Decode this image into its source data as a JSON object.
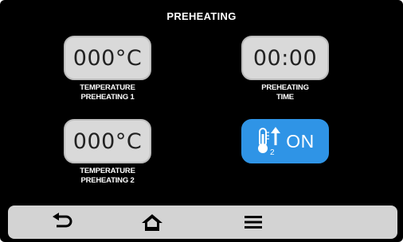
{
  "screen": {
    "title": "PREHEATING"
  },
  "tiles": {
    "temp1": {
      "value": "000°C",
      "caption_line1": "TEMPERATURE",
      "caption_line2": "PREHEATING 1"
    },
    "time": {
      "value": "00:00",
      "caption_line1": "PREHEATING",
      "caption_line2": "TIME"
    },
    "temp2": {
      "value": "000°C",
      "caption_line1": "TEMPERATURE",
      "caption_line2": "PREHEATING 2"
    },
    "toggle": {
      "label": "ON",
      "icon": "thermometer-up-2-icon",
      "sub_label": "2"
    }
  },
  "nav": {
    "back_icon": "back-arrow-icon",
    "home_icon": "home-icon",
    "menu_icon": "menu-icon"
  },
  "colors": {
    "background": "#000000",
    "tile": "#d9d9d9",
    "accent": "#2f94e6",
    "nav_bar": "#d3d3d3"
  }
}
